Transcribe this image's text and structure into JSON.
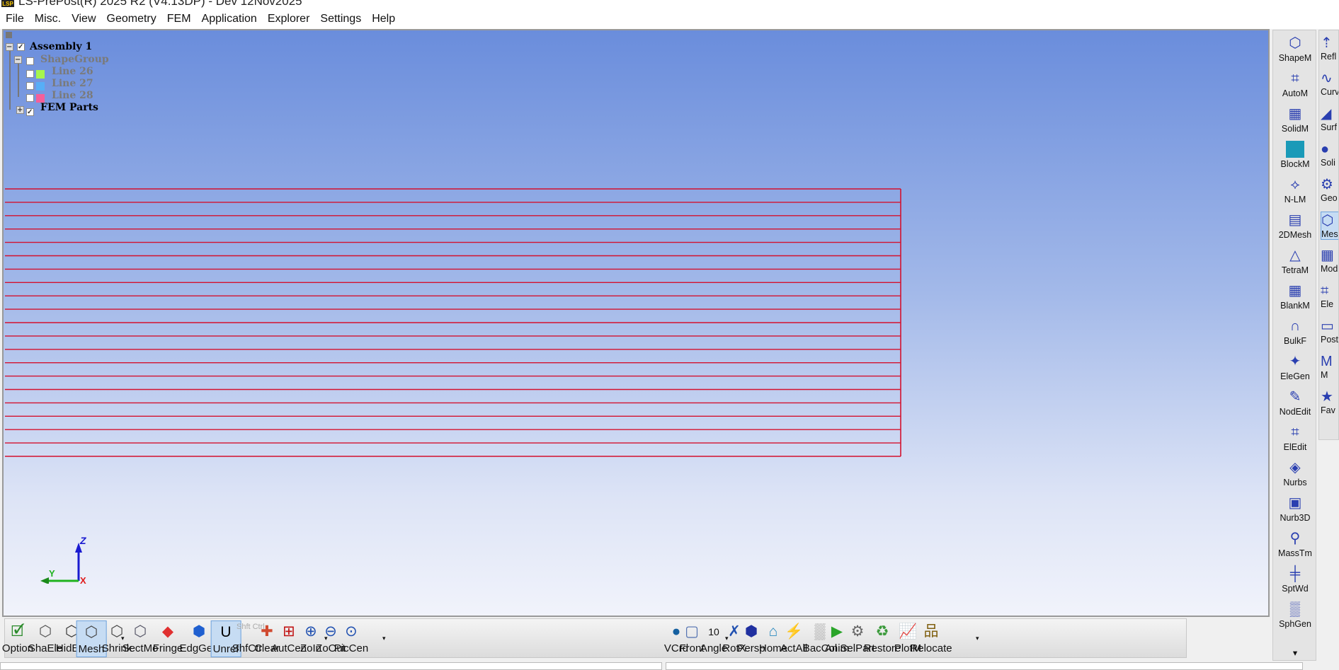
{
  "window": {
    "title": "LS-PrePost(R) 2025 R2 (V4.13DP) - Dev 12Nov2025"
  },
  "menu": [
    "File",
    "Misc.",
    "View",
    "Geometry",
    "FEM",
    "Application",
    "Explorer",
    "Settings",
    "Help"
  ],
  "tree": {
    "assembly": "Assembly 1",
    "shape_group": "ShapeGroup",
    "lines": [
      {
        "label": "Line 26",
        "color": "#a6f54d"
      },
      {
        "label": "Line 27",
        "color": "#57aef7"
      },
      {
        "label": "Line 28",
        "color": "#f55f9a"
      }
    ],
    "fem_parts": "FEM Parts"
  },
  "mesh": {
    "line_count": 21,
    "color": "#d4112e"
  },
  "triad": {
    "z": "Z",
    "y": "Y",
    "x": "X"
  },
  "right_panel_1": [
    "ShapeM",
    "AutoM",
    "SolidM",
    "BlockM",
    "N-LM",
    "2DMesh",
    "TetraM",
    "BlankM",
    "BulkF",
    "EleGen",
    "NodEdit",
    "ElEdit",
    "Nurbs",
    "Nurb3D",
    "MassTm",
    "SptWd",
    "SphGen"
  ],
  "right_panel_2": [
    "Refl",
    "Curv",
    "Surf",
    "Soli",
    "Geo",
    "Mesh",
    "Mod",
    "Ele",
    "Post",
    "M",
    "Fav"
  ],
  "toolbar": {
    "items": [
      "Option",
      "ShaEle",
      "HidEle",
      "Mesh",
      "Shrink",
      "SectMo",
      "Fringe",
      "EdgGeo",
      "Unref",
      "ShfCtr",
      "Clear",
      "AutCen",
      "ZoIn",
      "ZoOut",
      "PicCen",
      "VCrd",
      "Front",
      "Angle",
      "RotX",
      "Persp",
      "Home",
      "ActAll",
      "BacCol",
      "Anim",
      "SelPart",
      "Restore",
      "PlotM",
      "Relocate"
    ],
    "angle_value": "10",
    "shfctr_icon_text": "Shft Ctrl",
    "unref_icon": "U"
  }
}
